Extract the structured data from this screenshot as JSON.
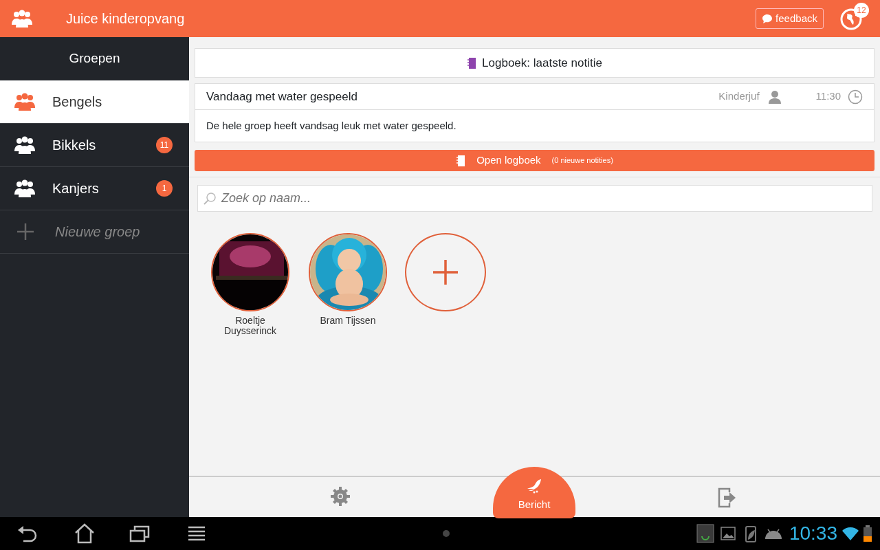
{
  "app": {
    "title": "Juice kinderopvang",
    "feedback_button": "feedback",
    "notification_count": "12"
  },
  "sidebar": {
    "heading": "Groepen",
    "items": [
      {
        "label": "Bengels",
        "selected": true
      },
      {
        "label": "Bikkels",
        "selected": false,
        "badge": "11"
      },
      {
        "label": "Kanjers",
        "selected": false,
        "badge": "1"
      }
    ],
    "new_group": "Nieuwe groep"
  },
  "logbook": {
    "header": "Logboek: laatste notitie",
    "note": {
      "title": "Vandaag met water gespeeld",
      "author": "Kinderjuf",
      "time": "11:30",
      "body": "De hele groep heeft vandsag leuk met water gespeeld."
    },
    "open_button": "Open logboek",
    "new_count": "(0 nieuwe notities)"
  },
  "search": {
    "placeholder": "Zoek op naam..."
  },
  "kids": [
    {
      "name": "Roeltje Duysserinck",
      "kind": "picture"
    },
    {
      "name": "Bram Tijssen",
      "kind": "picture"
    }
  ],
  "bottom_bar": {
    "message_button": "Bericht"
  },
  "system_bar": {
    "time": "10:33"
  }
}
